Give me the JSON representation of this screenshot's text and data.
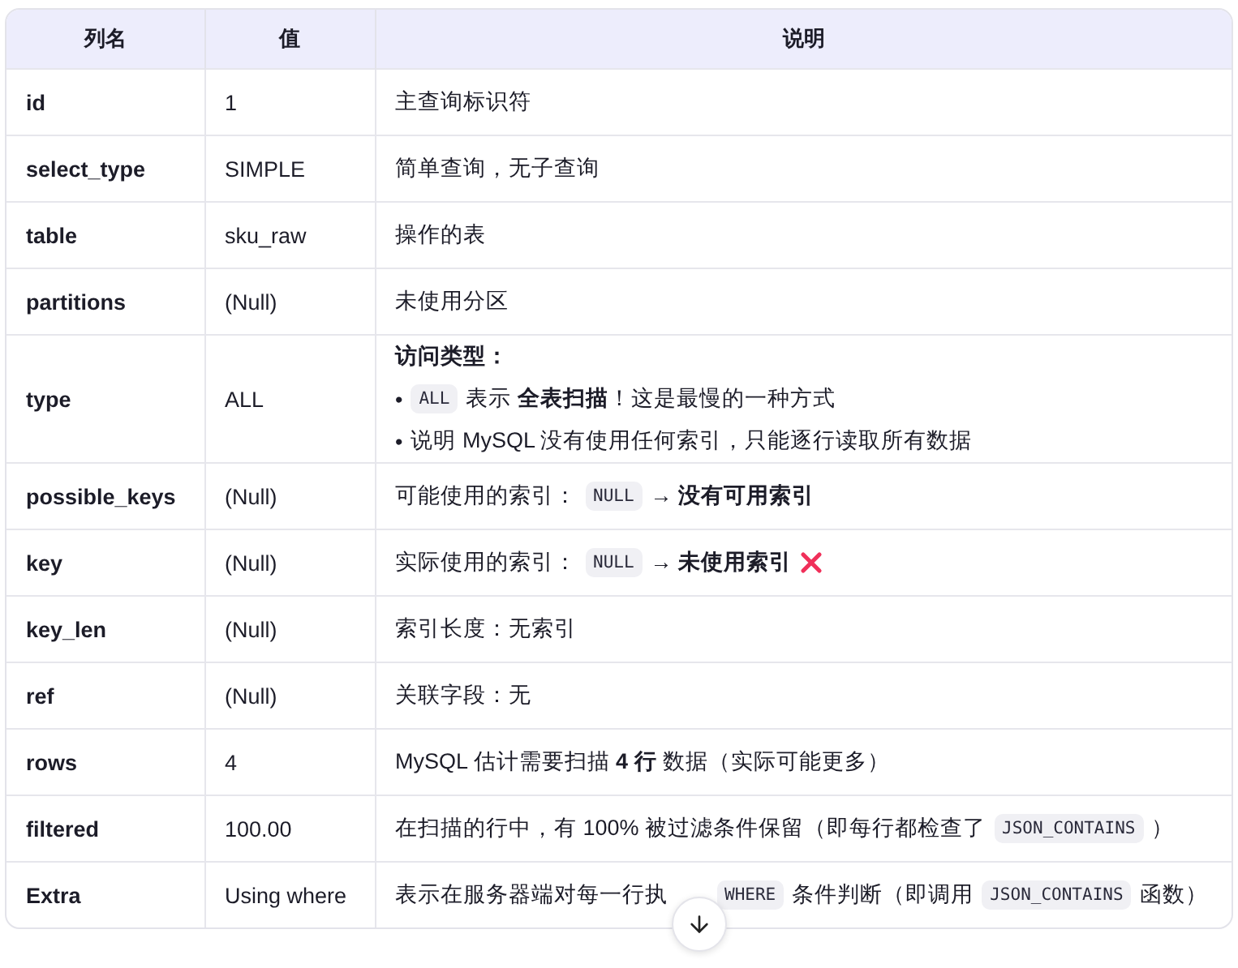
{
  "table": {
    "columns": [
      "列名",
      "值",
      "说明"
    ],
    "rows": [
      {
        "name": "id",
        "value": "1",
        "description": [
          {
            "kind": "plain",
            "parts": [
              {
                "kind": "text",
                "text": "主查询标识符"
              }
            ]
          }
        ]
      },
      {
        "name": "select_type",
        "value": "SIMPLE",
        "description": [
          {
            "kind": "plain",
            "parts": [
              {
                "kind": "text",
                "text": "简单查询，无子查询"
              }
            ]
          }
        ]
      },
      {
        "name": "table",
        "value": "sku_raw",
        "description": [
          {
            "kind": "plain",
            "parts": [
              {
                "kind": "text",
                "text": "操作的表"
              }
            ]
          }
        ]
      },
      {
        "name": "partitions",
        "value": "(Null)",
        "description": [
          {
            "kind": "plain",
            "parts": [
              {
                "kind": "text",
                "text": "未使用分区"
              }
            ]
          }
        ]
      },
      {
        "name": "type",
        "value": "ALL",
        "description": [
          {
            "kind": "heading",
            "parts": [
              {
                "kind": "text",
                "text": "访问类型："
              }
            ]
          },
          {
            "kind": "bullet",
            "marker": "•",
            "parts": [
              {
                "kind": "code",
                "text": "ALL"
              },
              {
                "kind": "text",
                "text": "表示 **全表扫描**！这是最慢的一种方式"
              }
            ]
          },
          {
            "kind": "bullet",
            "marker": "•",
            "parts": [
              {
                "kind": "text",
                "text": "说明 MySQL 没有使用任何索引，只能逐行读取所有数据"
              }
            ]
          }
        ]
      },
      {
        "name": "possible_keys",
        "value": "(Null)",
        "description": [
          {
            "kind": "plain",
            "parts": [
              {
                "kind": "text",
                "text": "可能使用的索引："
              },
              {
                "kind": "code",
                "text": "NULL"
              },
              {
                "kind": "text",
                "text": "→ **没有可用索引**"
              }
            ]
          }
        ]
      },
      {
        "name": "key",
        "value": "(Null)",
        "description": [
          {
            "kind": "plain",
            "parts": [
              {
                "kind": "text",
                "text": "实际使用的索引："
              },
              {
                "kind": "code",
                "text": "NULL"
              },
              {
                "kind": "text",
                "text": "→ **未使用索引**"
              },
              {
                "kind": "cross"
              }
            ]
          }
        ]
      },
      {
        "name": "key_len",
        "value": "(Null)",
        "description": [
          {
            "kind": "plain",
            "parts": [
              {
                "kind": "text",
                "text": "索引长度：无索引"
              }
            ]
          }
        ]
      },
      {
        "name": "ref",
        "value": "(Null)",
        "description": [
          {
            "kind": "plain",
            "parts": [
              {
                "kind": "text",
                "text": "关联字段：无"
              }
            ]
          }
        ]
      },
      {
        "name": "rows",
        "value": "4",
        "description": [
          {
            "kind": "plain",
            "parts": [
              {
                "kind": "text",
                "text": "MySQL 估计需要扫描 **4 行** 数据（实际可能更多）"
              }
            ]
          }
        ]
      },
      {
        "name": "filtered",
        "value": "100.00",
        "description": [
          {
            "kind": "plain",
            "parts": [
              {
                "kind": "text",
                "text": "在扫描的行中，有 100% 被过滤条件保留（即每行都检查了"
              },
              {
                "kind": "code",
                "text": "JSON_CONTAINS"
              },
              {
                "kind": "text",
                "text": "）"
              }
            ]
          }
        ]
      },
      {
        "name": "Extra",
        "value": "Using where",
        "description": [
          {
            "kind": "plain",
            "parts": [
              {
                "kind": "text",
                "text": "表示在服务器端对每一行执"
              },
              {
                "kind": "gap"
              },
              {
                "kind": "code",
                "text": "WHERE"
              },
              {
                "kind": "text",
                "text": "条件判断（即调用"
              },
              {
                "kind": "code",
                "text": "JSON_CONTAINS"
              },
              {
                "kind": "text",
                "text": "函数）"
              }
            ]
          }
        ]
      }
    ]
  },
  "scroll_button": {
    "kind": "down"
  }
}
